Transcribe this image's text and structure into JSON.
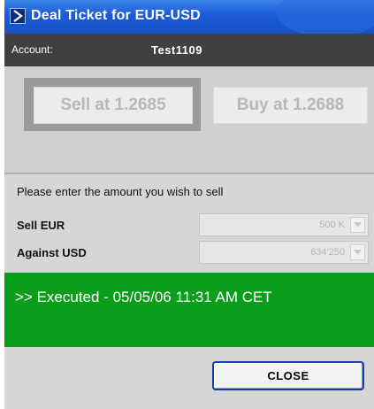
{
  "window": {
    "title": "Deal Ticket for EUR-USD"
  },
  "account": {
    "label": "Account:",
    "value": "Test1109"
  },
  "prices": {
    "sell_label": "Sell at 1.2685",
    "buy_label": "Buy at 1.2688"
  },
  "amount": {
    "prompt": "Please enter the amount you wish to sell",
    "sell_label": "Sell EUR",
    "sell_value": "500 K",
    "against_label": "Against USD",
    "against_value": "634'250"
  },
  "status": {
    "message": ">> Executed - 05/05/06 11:31 AM CET"
  },
  "footer": {
    "close_label": "CLOSE"
  },
  "colors": {
    "title_bar": "#1b5bd6",
    "account_bar": "#404040",
    "status_success": "#0b9e1a",
    "close_border": "#1a3ea8"
  }
}
